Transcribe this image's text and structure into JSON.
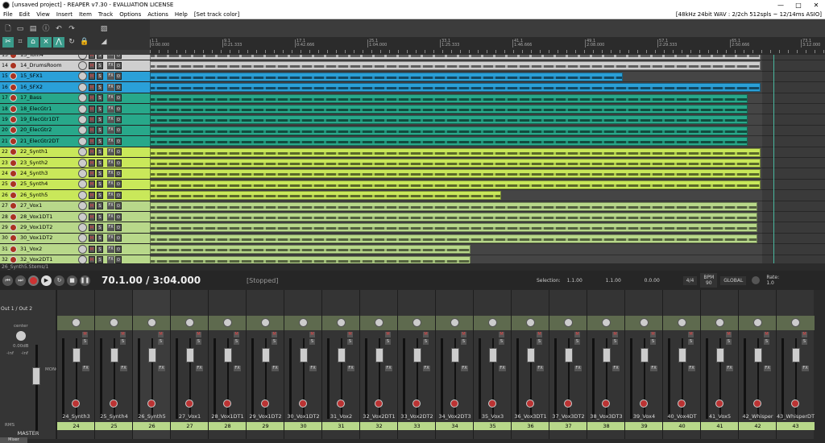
{
  "window": {
    "title": "[unsaved project] - REAPER v7.30 - EVALUATION LICENSE",
    "min": "—",
    "max": "□",
    "close": "✕"
  },
  "menu": {
    "items": [
      "File",
      "Edit",
      "View",
      "Insert",
      "Item",
      "Track",
      "Options",
      "Actions",
      "Help",
      "[Set track color]"
    ],
    "status": "[48kHz 24bit WAV : 2/2ch 512spls ~ 12/14ms ASIO]"
  },
  "ruler": {
    "marks": [
      {
        "bar": "1.1",
        "time": "0:00.000"
      },
      {
        "bar": "9.1",
        "time": "0:21.333"
      },
      {
        "bar": "17.1",
        "time": "0:42.666"
      },
      {
        "bar": "25.1",
        "time": "1:04.000"
      },
      {
        "bar": "33.1",
        "time": "1:25.333"
      },
      {
        "bar": "41.1",
        "time": "1:46.666"
      },
      {
        "bar": "49.1",
        "time": "2:08.000"
      },
      {
        "bar": "57.1",
        "time": "2:29.333"
      },
      {
        "bar": "65.1",
        "time": "2:50.666"
      },
      {
        "bar": "73.1",
        "time": "3:12.000"
      }
    ]
  },
  "tracks": [
    {
      "num": "13",
      "name": "13_Tom4",
      "color": "#cfcfcf",
      "clip_end": 0.905
    },
    {
      "num": "14",
      "name": "14_DrumsRoom",
      "color": "#cfcfcf",
      "clip_end": 0.905
    },
    {
      "num": "15",
      "name": "15_SFX1",
      "color": "#2aa0d8",
      "clip_end": 0.7
    },
    {
      "num": "16",
      "name": "16_SFX2",
      "color": "#2aa0d8",
      "clip_end": 0.905
    },
    {
      "num": "17",
      "name": "17_Bass",
      "color": "#28a88a",
      "clip_end": 0.885
    },
    {
      "num": "18",
      "name": "18_ElecGtr1",
      "color": "#28a88a",
      "clip_end": 0.885
    },
    {
      "num": "19",
      "name": "19_ElecGtr1DT",
      "color": "#28a88a",
      "clip_end": 0.885
    },
    {
      "num": "20",
      "name": "20_ElecGtr2",
      "color": "#28a88a",
      "clip_end": 0.885
    },
    {
      "num": "21",
      "name": "21_ElecGtr2DT",
      "color": "#28a88a",
      "clip_end": 0.885
    },
    {
      "num": "22",
      "name": "22_Synth1",
      "color": "#c9e85a",
      "clip_end": 0.905
    },
    {
      "num": "23",
      "name": "23_Synth2",
      "color": "#c9e85a",
      "clip_end": 0.905
    },
    {
      "num": "24",
      "name": "24_Synth3",
      "color": "#c9e85a",
      "clip_end": 0.905
    },
    {
      "num": "25",
      "name": "25_Synth4",
      "color": "#c9e85a",
      "clip_end": 0.905
    },
    {
      "num": "26",
      "name": "26_Synth5",
      "color": "#c9e85a",
      "clip_end": 0.52
    },
    {
      "num": "27",
      "name": "27_Vox1",
      "color": "#b8d88a",
      "clip_end": 0.9
    },
    {
      "num": "28",
      "name": "28_Vox1DT1",
      "color": "#b8d88a",
      "clip_end": 0.9
    },
    {
      "num": "29",
      "name": "29_Vox1DT2",
      "color": "#b8d88a",
      "clip_end": 0.9
    },
    {
      "num": "30",
      "name": "30_Vox1DT2",
      "color": "#b8d88a",
      "clip_end": 0.9
    },
    {
      "num": "31",
      "name": "31_Vox2",
      "color": "#b8d88a",
      "clip_end": 0.475
    },
    {
      "num": "32",
      "name": "32_Vox2DT1",
      "color": "#b8d88a",
      "clip_end": 0.475
    }
  ],
  "track_buttons": {
    "mute": "M",
    "solo": "S",
    "fx": "FX"
  },
  "status_line": "26_Synth5.Stems/1",
  "transport": {
    "position": "70.1.00 / 3:04.000",
    "state": "[Stopped]",
    "selection_label": "Selection:",
    "sel_start": "1.1.00",
    "sel_end": "1.1.00",
    "sel_len": "0.0.00",
    "timesig": "4/4",
    "bpm_label": "BPM",
    "bpm": "90",
    "global_label": "GLOBAL",
    "rate_label": "Rate:",
    "rate": "1.0"
  },
  "mixer": {
    "master": {
      "out": "Out 1 / Out 2",
      "pan": "center",
      "vol": "0.00dB",
      "name": "MASTER",
      "rms": "RMS",
      "inf1": "-inf",
      "inf2": "-inf",
      "mono": "MONO"
    },
    "strips": [
      {
        "name": "24_Synth3",
        "num": "24"
      },
      {
        "name": "25_Synth4",
        "num": "25"
      },
      {
        "name": "26_Synth5",
        "num": "26"
      },
      {
        "name": "27_Vox1",
        "num": "27"
      },
      {
        "name": "28_Vox1DT1",
        "num": "28"
      },
      {
        "name": "29_Vox1DT2",
        "num": "29"
      },
      {
        "name": "30_Vox1DT2",
        "num": "30"
      },
      {
        "name": "31_Vox2",
        "num": "31"
      },
      {
        "name": "32_Vox2DT1",
        "num": "32"
      },
      {
        "name": "33_Vox2DT2",
        "num": "33"
      },
      {
        "name": "34_Vox2DT3",
        "num": "34"
      },
      {
        "name": "35_Vox3",
        "num": "35"
      },
      {
        "name": "36_Vox3DT1",
        "num": "36"
      },
      {
        "name": "37_Vox3DT2",
        "num": "37"
      },
      {
        "name": "38_Vox3DT3",
        "num": "38"
      },
      {
        "name": "39_Vox4",
        "num": "39"
      },
      {
        "name": "40_Vox4DT",
        "num": "40"
      },
      {
        "name": "41_Vox5",
        "num": "41"
      },
      {
        "name": "42_Whisper",
        "num": "42"
      },
      {
        "name": "43_WhisperDT",
        "num": "43"
      }
    ],
    "tab": "Mixer"
  }
}
